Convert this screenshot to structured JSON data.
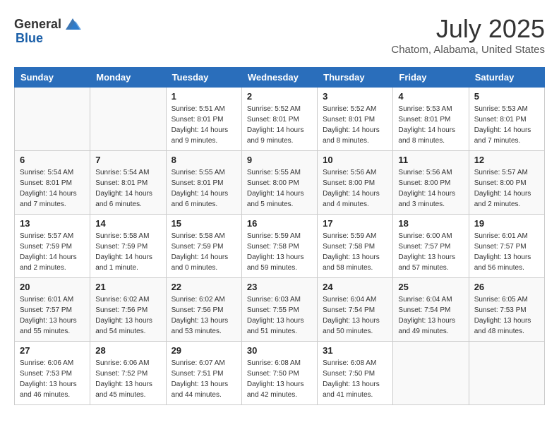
{
  "header": {
    "logo_general": "General",
    "logo_blue": "Blue",
    "title": "July 2025",
    "location": "Chatom, Alabama, United States"
  },
  "calendar": {
    "days_of_week": [
      "Sunday",
      "Monday",
      "Tuesday",
      "Wednesday",
      "Thursday",
      "Friday",
      "Saturday"
    ],
    "weeks": [
      [
        {
          "day": "",
          "info": ""
        },
        {
          "day": "",
          "info": ""
        },
        {
          "day": "1",
          "info": "Sunrise: 5:51 AM\nSunset: 8:01 PM\nDaylight: 14 hours\nand 9 minutes."
        },
        {
          "day": "2",
          "info": "Sunrise: 5:52 AM\nSunset: 8:01 PM\nDaylight: 14 hours\nand 9 minutes."
        },
        {
          "day": "3",
          "info": "Sunrise: 5:52 AM\nSunset: 8:01 PM\nDaylight: 14 hours\nand 8 minutes."
        },
        {
          "day": "4",
          "info": "Sunrise: 5:53 AM\nSunset: 8:01 PM\nDaylight: 14 hours\nand 8 minutes."
        },
        {
          "day": "5",
          "info": "Sunrise: 5:53 AM\nSunset: 8:01 PM\nDaylight: 14 hours\nand 7 minutes."
        }
      ],
      [
        {
          "day": "6",
          "info": "Sunrise: 5:54 AM\nSunset: 8:01 PM\nDaylight: 14 hours\nand 7 minutes."
        },
        {
          "day": "7",
          "info": "Sunrise: 5:54 AM\nSunset: 8:01 PM\nDaylight: 14 hours\nand 6 minutes."
        },
        {
          "day": "8",
          "info": "Sunrise: 5:55 AM\nSunset: 8:01 PM\nDaylight: 14 hours\nand 6 minutes."
        },
        {
          "day": "9",
          "info": "Sunrise: 5:55 AM\nSunset: 8:00 PM\nDaylight: 14 hours\nand 5 minutes."
        },
        {
          "day": "10",
          "info": "Sunrise: 5:56 AM\nSunset: 8:00 PM\nDaylight: 14 hours\nand 4 minutes."
        },
        {
          "day": "11",
          "info": "Sunrise: 5:56 AM\nSunset: 8:00 PM\nDaylight: 14 hours\nand 3 minutes."
        },
        {
          "day": "12",
          "info": "Sunrise: 5:57 AM\nSunset: 8:00 PM\nDaylight: 14 hours\nand 2 minutes."
        }
      ],
      [
        {
          "day": "13",
          "info": "Sunrise: 5:57 AM\nSunset: 7:59 PM\nDaylight: 14 hours\nand 2 minutes."
        },
        {
          "day": "14",
          "info": "Sunrise: 5:58 AM\nSunset: 7:59 PM\nDaylight: 14 hours\nand 1 minute."
        },
        {
          "day": "15",
          "info": "Sunrise: 5:58 AM\nSunset: 7:59 PM\nDaylight: 14 hours\nand 0 minutes."
        },
        {
          "day": "16",
          "info": "Sunrise: 5:59 AM\nSunset: 7:58 PM\nDaylight: 13 hours\nand 59 minutes."
        },
        {
          "day": "17",
          "info": "Sunrise: 5:59 AM\nSunset: 7:58 PM\nDaylight: 13 hours\nand 58 minutes."
        },
        {
          "day": "18",
          "info": "Sunrise: 6:00 AM\nSunset: 7:57 PM\nDaylight: 13 hours\nand 57 minutes."
        },
        {
          "day": "19",
          "info": "Sunrise: 6:01 AM\nSunset: 7:57 PM\nDaylight: 13 hours\nand 56 minutes."
        }
      ],
      [
        {
          "day": "20",
          "info": "Sunrise: 6:01 AM\nSunset: 7:57 PM\nDaylight: 13 hours\nand 55 minutes."
        },
        {
          "day": "21",
          "info": "Sunrise: 6:02 AM\nSunset: 7:56 PM\nDaylight: 13 hours\nand 54 minutes."
        },
        {
          "day": "22",
          "info": "Sunrise: 6:02 AM\nSunset: 7:56 PM\nDaylight: 13 hours\nand 53 minutes."
        },
        {
          "day": "23",
          "info": "Sunrise: 6:03 AM\nSunset: 7:55 PM\nDaylight: 13 hours\nand 51 minutes."
        },
        {
          "day": "24",
          "info": "Sunrise: 6:04 AM\nSunset: 7:54 PM\nDaylight: 13 hours\nand 50 minutes."
        },
        {
          "day": "25",
          "info": "Sunrise: 6:04 AM\nSunset: 7:54 PM\nDaylight: 13 hours\nand 49 minutes."
        },
        {
          "day": "26",
          "info": "Sunrise: 6:05 AM\nSunset: 7:53 PM\nDaylight: 13 hours\nand 48 minutes."
        }
      ],
      [
        {
          "day": "27",
          "info": "Sunrise: 6:06 AM\nSunset: 7:53 PM\nDaylight: 13 hours\nand 46 minutes."
        },
        {
          "day": "28",
          "info": "Sunrise: 6:06 AM\nSunset: 7:52 PM\nDaylight: 13 hours\nand 45 minutes."
        },
        {
          "day": "29",
          "info": "Sunrise: 6:07 AM\nSunset: 7:51 PM\nDaylight: 13 hours\nand 44 minutes."
        },
        {
          "day": "30",
          "info": "Sunrise: 6:08 AM\nSunset: 7:50 PM\nDaylight: 13 hours\nand 42 minutes."
        },
        {
          "day": "31",
          "info": "Sunrise: 6:08 AM\nSunset: 7:50 PM\nDaylight: 13 hours\nand 41 minutes."
        },
        {
          "day": "",
          "info": ""
        },
        {
          "day": "",
          "info": ""
        }
      ]
    ]
  }
}
